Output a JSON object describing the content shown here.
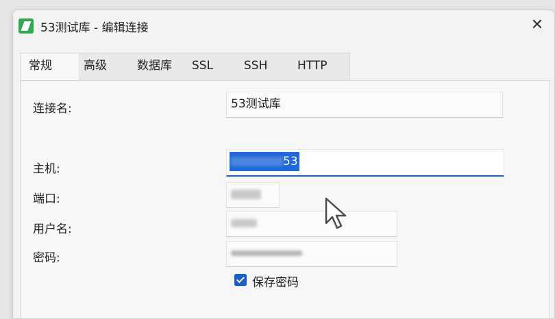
{
  "window": {
    "title": "53测试库 - 编辑连接",
    "close_symbol": "✕"
  },
  "tabs": [
    {
      "label": "常规",
      "active": true
    },
    {
      "label": "高级",
      "active": false
    },
    {
      "label": "数据库",
      "active": false
    },
    {
      "label": "SSL",
      "active": false
    },
    {
      "label": "SSH",
      "active": false
    },
    {
      "label": "HTTP",
      "active": false
    }
  ],
  "form": {
    "connection_name_label": "连接名:",
    "connection_name_value": "53测试库",
    "host_label": "主机:",
    "host_value_visible_suffix": "53",
    "port_label": "端口:",
    "username_label": "用户名:",
    "password_label": "密码:",
    "save_password_label": "保存密码",
    "save_password_checked": true
  },
  "colors": {
    "accent": "#1a62c5",
    "app_icon": "#2fa84f"
  },
  "icons": {
    "app": "navicat-app-icon",
    "close": "close-icon",
    "cursor": "mouse-pointer-icon"
  }
}
